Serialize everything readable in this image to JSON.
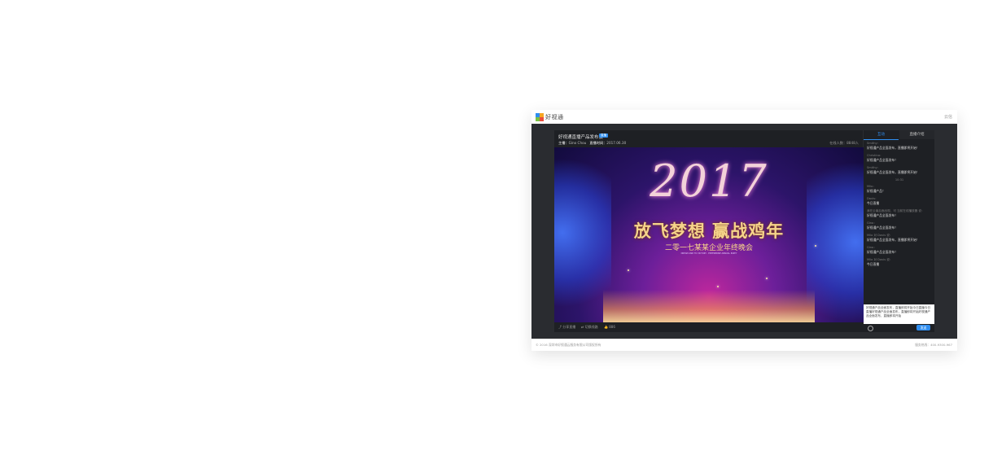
{
  "header": {
    "brand": "好视通",
    "right_link": "云信"
  },
  "video": {
    "title": "好视通直播产品发布会",
    "badge": "直播",
    "host_label": "主播：",
    "host_name": "Gino Chou",
    "time_label": "直播时间：",
    "time_value": "2017.06.30",
    "viewers": "在线人数：8848人",
    "poster": {
      "year": "2017",
      "slogan": "放飞梦想 赢战鸡年",
      "subtitle": "二零一七某某企业年终晚会",
      "small": "DREAM AND TO VICTORY · ENTERPRISE ANNUAL PARTY"
    },
    "controls": {
      "share": "分享直播",
      "switch": "切换线路",
      "like": "886"
    }
  },
  "chat": {
    "tabs": [
      "互动",
      "直播介绍"
    ],
    "messages_top": [
      {
        "user": "Smithy：",
        "text": "好视通产品全面发布，直播即将开始！"
      },
      {
        "user": "Christina：",
        "text": "好视通产品全面发布！"
      },
      {
        "user": "Smithy：",
        "text": "好视通产品全面发布，直播即将开始！"
      }
    ],
    "separator": "10:31",
    "messages_bottom": [
      {
        "user": "Milo：",
        "text": "好视通产品！"
      },
      {
        "user": "Davis：",
        "text": "今日直播"
      },
      {
        "user": "我在云南后面出现，可 当前在线播放器 说：",
        "text": "好视通产品全面发布！"
      },
      {
        "user": "Gino：",
        "text": "好视通产品全面发布！"
      },
      {
        "user": "Milo 对 Davis 说：",
        "text": "好视通产品全面发布，直播即将开始！"
      },
      {
        "user": "Gino：",
        "text": "好视通产品全面发布！"
      },
      {
        "user": "Milo 对 Davis 说：",
        "text": "今日直播"
      }
    ],
    "input_text": "好视通产品全面发布，直播即将开始今日直播今日直播好视通产品全面发布，直播即将开始好视通产品全面发布，直播即将开始",
    "send_label": "发送"
  },
  "footer": {
    "left": "© 2016 深圳市好视通云服务有限公司版权所有",
    "right": "服务热线：400-9300-967"
  }
}
